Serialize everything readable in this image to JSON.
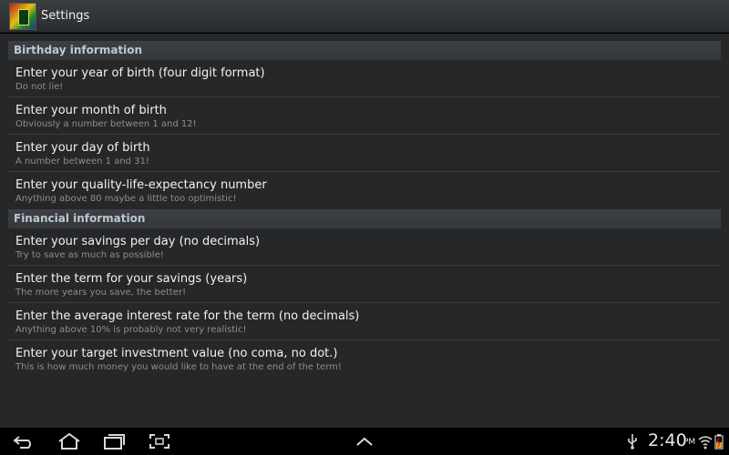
{
  "action_bar": {
    "title": "Settings",
    "icon": "app-logo-icon"
  },
  "sections": [
    {
      "header": "Birthday information",
      "items": [
        {
          "title": "Enter your year of birth (four digit format)",
          "summary": "Do not lie!"
        },
        {
          "title": "Enter your month of birth",
          "summary": "Obviously a number between 1 and 12!"
        },
        {
          "title": "Enter your day of birth",
          "summary": "A number between 1 and 31!"
        },
        {
          "title": "Enter your quality-life-expectancy number",
          "summary": "Anything above 80 maybe a little too optimistic!"
        }
      ]
    },
    {
      "header": "Financial information",
      "items": [
        {
          "title": "Enter your savings per day (no decimals)",
          "summary": "Try to save as much as possible!"
        },
        {
          "title": "Enter the term for your savings (years)",
          "summary": "The more years you save, the better!"
        },
        {
          "title": "Enter the average interest rate for the term (no decimals)",
          "summary": "Anything above 10% is probably not very realistic!"
        },
        {
          "title": "Enter your target investment value (no coma, no dot.)",
          "summary": "This is how much money you would like to have at the end of the term!"
        }
      ]
    }
  ],
  "system_bar": {
    "time": "2:40",
    "ampm": "PM",
    "icons": [
      "back-icon",
      "home-icon",
      "recent-apps-icon",
      "screenshot-icon",
      "menu-up-icon",
      "usb-icon",
      "wifi-icon",
      "battery-icon"
    ]
  },
  "colors": {
    "background": "#262729",
    "section_header_text": "#b9c9d6",
    "system_bar": "#000000"
  }
}
